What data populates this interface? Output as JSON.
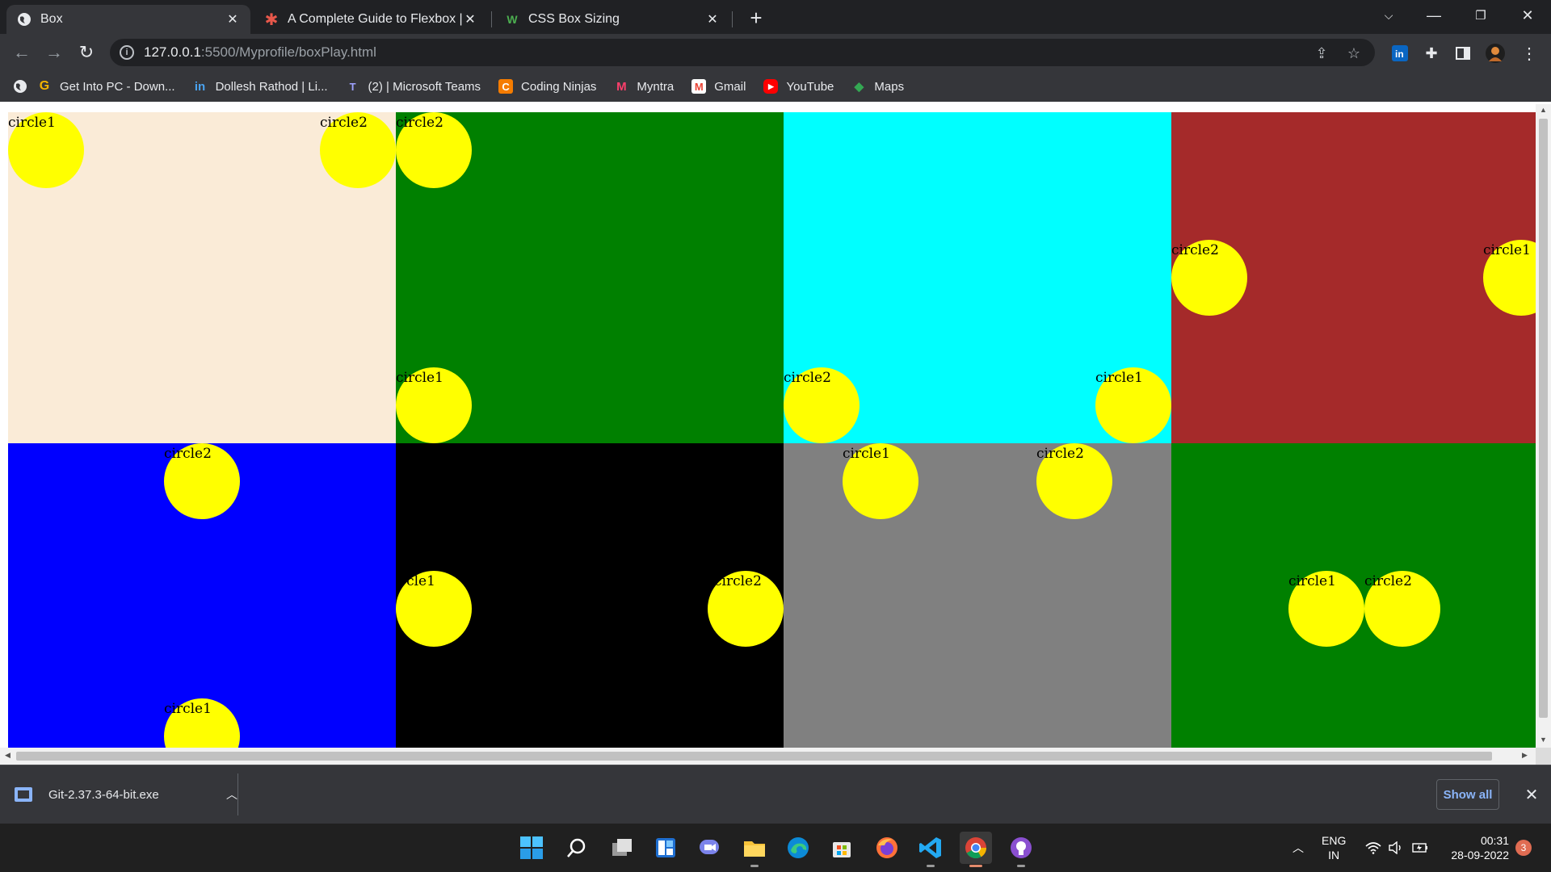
{
  "tabs": [
    {
      "title": "Box",
      "favicon": "globe-icon",
      "active": true
    },
    {
      "title": "A Complete Guide to Flexbox | CSS",
      "favicon": "css-tricks-icon",
      "active": false
    },
    {
      "title": "CSS Box Sizing",
      "favicon": "w3schools-icon",
      "active": false
    }
  ],
  "toolbar": {
    "url_host": "127.0.0.1",
    "url_path": ":5500/Myprofile/boxPlay.html"
  },
  "bookmarks": [
    {
      "label": "Get Into PC - Down...",
      "icon": "G",
      "color": "#f4b400"
    },
    {
      "label": "Dollesh Rathod | Li...",
      "icon": "in",
      "color": "#0a66c2"
    },
    {
      "label": "(2) | Microsoft Teams",
      "icon": "T",
      "color": "#6264a7"
    },
    {
      "label": "Coding Ninjas",
      "icon": "C",
      "color": "#f57c00"
    },
    {
      "label": "Myntra",
      "icon": "M",
      "color": "#ff3f6c"
    },
    {
      "label": "Gmail",
      "icon": "M",
      "color": "#ea4335"
    },
    {
      "label": "YouTube",
      "icon": "▶",
      "color": "#ff0000"
    },
    {
      "label": "Maps",
      "icon": "◆",
      "color": "#34a853"
    }
  ],
  "boxes": [
    {
      "name": "box-1",
      "color": "#faebd7",
      "circles": [
        {
          "label": "circle1"
        },
        {
          "label": "circle2"
        }
      ]
    },
    {
      "name": "box-2",
      "color": "#008000",
      "circles": [
        {
          "label": "circle2"
        },
        {
          "label": "circle1"
        }
      ]
    },
    {
      "name": "box-3",
      "color": "#00ffff",
      "circles": [
        {
          "label": "circle2"
        },
        {
          "label": "circle1"
        }
      ]
    },
    {
      "name": "box-4",
      "color": "#a52a2a",
      "circles": [
        {
          "label": "circle2"
        },
        {
          "label": "circle1"
        }
      ]
    },
    {
      "name": "box-5",
      "color": "#0000ff",
      "circles": [
        {
          "label": "circle2"
        },
        {
          "label": "circle1"
        }
      ]
    },
    {
      "name": "box-6",
      "color": "#000000",
      "circles": [
        {
          "label": "circle1"
        },
        {
          "label": "circle2"
        }
      ]
    },
    {
      "name": "box-7",
      "color": "#808080",
      "circles": [
        {
          "label": "circle1"
        },
        {
          "label": "circle2"
        }
      ]
    },
    {
      "name": "box-8",
      "color": "#008000",
      "circles": [
        {
          "label": "circle1"
        },
        {
          "label": "circle2"
        }
      ]
    }
  ],
  "downloads": {
    "file_name": "Git-2.37.3-64-bit.exe",
    "show_all_label": "Show all"
  },
  "taskbar": {
    "apps": [
      "start-icon",
      "search-icon",
      "task-view-icon",
      "widgets-icon",
      "teams-chat-icon",
      "file-explorer-icon",
      "edge-icon",
      "store-icon",
      "firefox-icon",
      "vscode-icon",
      "chrome-icon",
      "github-desktop-icon"
    ],
    "language_line1": "ENG",
    "language_line2": "IN",
    "time": "00:31",
    "date": "28-09-2022",
    "notification_count": "3"
  }
}
